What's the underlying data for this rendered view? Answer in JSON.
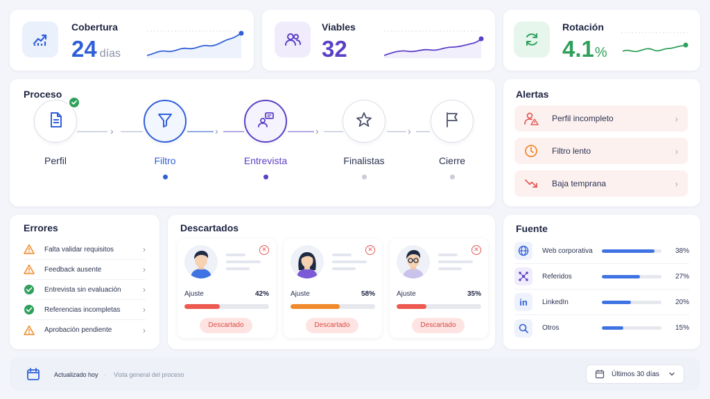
{
  "kpis": [
    {
      "label": "Cobertura",
      "value": "24",
      "unit": "días",
      "color": "#2f5fd8",
      "icon": "trend-up-icon"
    },
    {
      "label": "Viables",
      "value": "32",
      "unit": "",
      "color": "#5b3fc6",
      "icon": "users-icon"
    },
    {
      "label": "Rotación",
      "value": "4.1",
      "unit": "%",
      "color": "#2ea05b",
      "icon": "refresh-icon"
    }
  ],
  "process": {
    "title": "Proceso",
    "steps": [
      {
        "label": "Perfil",
        "icon": "document-icon",
        "state": "done"
      },
      {
        "label": "Filtro",
        "icon": "filter-icon",
        "state": "active-blue"
      },
      {
        "label": "Entrevista",
        "icon": "interview-icon",
        "state": "active-purple"
      },
      {
        "label": "Finalistas",
        "icon": "star-icon",
        "state": "pending"
      },
      {
        "label": "Cierre",
        "icon": "flag-icon",
        "state": "pending"
      }
    ]
  },
  "alerts": {
    "title": "Alertas",
    "items": [
      {
        "label": "Perfil incompleto",
        "icon": "user-warning-icon"
      },
      {
        "label": "Filtro lento",
        "icon": "clock-icon"
      },
      {
        "label": "Baja temprana",
        "icon": "trend-down-icon"
      }
    ]
  },
  "errors": {
    "title": "Errores",
    "items": [
      {
        "label": "Falta validar requisitos",
        "status": "warning"
      },
      {
        "label": "Feedback ausente",
        "status": "warning"
      },
      {
        "label": "Entrevista sin evaluación",
        "status": "ok"
      },
      {
        "label": "Referencias incompletas",
        "status": "ok"
      },
      {
        "label": "Aprobación pendiente",
        "status": "warning"
      }
    ]
  },
  "discarded": {
    "title": "Descartados",
    "cards": [
      {
        "adjust_label": "Ajuste",
        "percent": "42%",
        "fill": 0.42,
        "bar_color": "#ec5a50",
        "status": "Descartado",
        "avatar": "male-avatar"
      },
      {
        "adjust_label": "Ajuste",
        "percent": "58%",
        "fill": 0.58,
        "bar_color": "#f08a2a",
        "status": "Descartado",
        "avatar": "female-avatar"
      },
      {
        "adjust_label": "Ajuste",
        "percent": "35%",
        "fill": 0.35,
        "bar_color": "#ec5a50",
        "status": "Descartado",
        "avatar": "male-glasses-avatar"
      }
    ]
  },
  "source": {
    "title": "Fuente",
    "items": [
      {
        "label": "Web corporativa",
        "percent": "38%",
        "fill": 0.88,
        "icon": "globe-icon"
      },
      {
        "label": "Referidos",
        "percent": "27%",
        "fill": 0.64,
        "icon": "network-icon"
      },
      {
        "label": "LinkedIn",
        "percent": "20%",
        "fill": 0.49,
        "icon": "linkedin-icon"
      },
      {
        "label": "Otros",
        "percent": "15%",
        "fill": 0.36,
        "icon": "search-icon"
      }
    ]
  },
  "footer": {
    "updated": "Actualizado hoy",
    "separator": "·",
    "subtitle": "Vista general del proceso",
    "range": "Últimos 30 días"
  }
}
